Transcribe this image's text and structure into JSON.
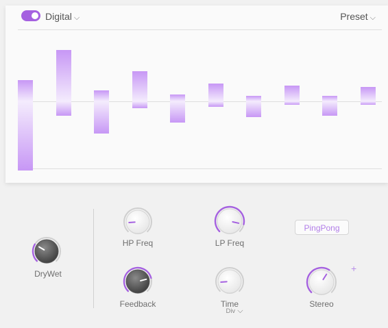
{
  "header": {
    "mode_label": "Digital",
    "preset_label": "Preset"
  },
  "colors": {
    "accent": "#a561e0",
    "bar_strong": "#c797f5",
    "bar_light": "#f4ecfd"
  },
  "icons": {
    "mode_dropdown": "chevron-down-icon",
    "preset_dropdown": "chevron-down-icon",
    "time_dropdown": "chevron-down-icon",
    "add": "plus-icon"
  },
  "taps": [
    {
      "up": 0.12,
      "down": 0.39
    },
    {
      "up": 0.29,
      "down": 0.08
    },
    {
      "up": 0.06,
      "down": 0.18
    },
    {
      "up": 0.17,
      "down": 0.04
    },
    {
      "up": 0.04,
      "down": 0.12
    },
    {
      "up": 0.1,
      "down": 0.03
    },
    {
      "up": 0.03,
      "down": 0.09
    },
    {
      "up": 0.09,
      "down": 0.02
    },
    {
      "up": 0.03,
      "down": 0.08
    },
    {
      "up": 0.08,
      "down": 0.02
    }
  ],
  "controls": {
    "drywet": {
      "label": "DryWet",
      "value": 0.28
    },
    "hp_freq": {
      "label": "HP Freq",
      "value": 0.15
    },
    "lp_freq": {
      "label": "LP Freq",
      "value": 0.88
    },
    "feedback": {
      "label": "Feedback",
      "value": 0.78
    },
    "time": {
      "label": "Time",
      "sub_label": "Div",
      "value": 0.15
    },
    "stereo": {
      "label": "Stereo",
      "value": 0.62
    }
  },
  "pingpong": {
    "label": "PingPong"
  },
  "plus": {
    "symbol": "+"
  }
}
